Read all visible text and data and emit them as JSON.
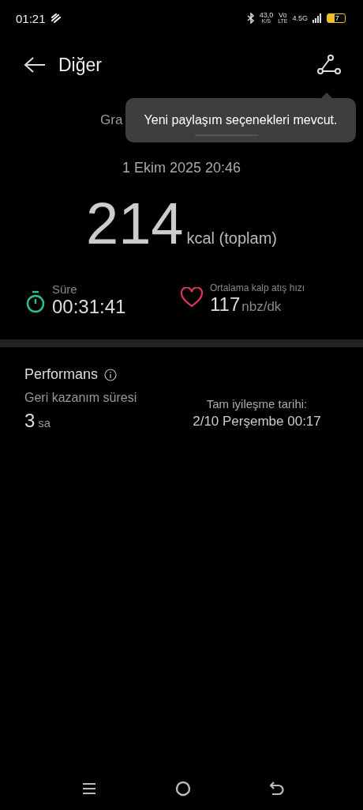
{
  "status_bar": {
    "time": "01:21",
    "speed": "43,0",
    "speed_unit": "K/S",
    "volte_top": "Vo",
    "volte_bottom": "LTE",
    "network": "4.5G",
    "battery": "7"
  },
  "header": {
    "title": "Diğer"
  },
  "tooltip": {
    "text": "Yeni paylaşım seçenekleri mevcut."
  },
  "summary": {
    "subtitle": "Gra",
    "date": "1 Ekim 2025 20:46",
    "calories": "214",
    "calories_unit": "kcal (toplam)"
  },
  "metrics": [
    {
      "kind": "timer",
      "label": "Süre",
      "value": "00:31:41",
      "color": "#2fbf8f"
    },
    {
      "kind": "heart",
      "label": "Ortalama kalp atış hızı",
      "value": "117",
      "unit": "nbz/dk",
      "color": "#e0355f"
    }
  ],
  "performance": {
    "title": "Performans",
    "recovery_label": "Geri kazanım süresi",
    "recovery_value": "3",
    "recovery_unit": "sa",
    "full_label": "Tam iyileşme tarihi:",
    "full_value": "2/10 Perşembe 00:17"
  }
}
